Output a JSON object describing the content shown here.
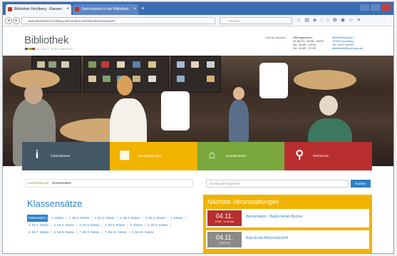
{
  "browser": {
    "tabs": [
      {
        "label": "Bibliothek Hochberg - Klassen"
      },
      {
        "label": "Sternstunden in der Bibliothek"
      }
    ],
    "new_tab": "+",
    "url": "www.bibliothek-hochberg.de/schulen-und-kitas/klassensaetze",
    "search_placeholder": "Suchen"
  },
  "site": {
    "logo": "Bibliothek",
    "logo_sub": "STADT HOCHBERG",
    "header_link": "Leichte Sprache",
    "hours": "Öffnungszeiten:\nDi. bis Fr.: 10:00 - 18:00\nSa.: 10:00 - 14:00\nSo.: 14:00 - 17:00",
    "address": "Bibliotheksplatz 1\n12345 Hochberg\nTel. 0123 456789\nbibliothek@hochberg.de"
  },
  "tiles": [
    {
      "icon": "i",
      "label": "Informationen",
      "color": "#445766"
    },
    {
      "icon": "▦",
      "label": "Veranstaltungen",
      "color": "#f2b300"
    },
    {
      "icon": "⌂",
      "label": "Lesestandorte",
      "color": "#7aa83c"
    },
    {
      "icon": "⚲",
      "label": "Recherche",
      "color": "#b82e2e"
    }
  ],
  "breadcrumb": {
    "home": "Leseförderung",
    "current": "Klassensätze"
  },
  "search": {
    "placeholder": "Suchbegriff eingeben",
    "button": "Suchen"
  },
  "klassensaetze": {
    "title": "Klassensätze",
    "items": [
      "Klassensätze",
      "1. Klasse",
      "1. bis 2. Klasse",
      "1. bis 3. Klasse",
      "2. bis 3. Klasse",
      "2. bis 4. Klasse",
      "3. Klasse",
      "3. bis 4. Klasse",
      "3. bis 5. Klasse",
      "4. bis 5. Klasse",
      "4. bis 6. Klasse",
      "5. Klasse",
      "5. bis 6. Klasse",
      "5. bis 7. Klasse",
      "5. bis 8. Klasse",
      "7. bis 8. Klasse",
      "7. bis 10. Klasse",
      "8. bis 10. Klasse"
    ]
  },
  "events": {
    "title": "Nächste Veranstaltungen",
    "items": [
      {
        "date": "04.11.",
        "time": "10:30 - 11:30 Uhr",
        "title": "Bücherbabys - Babys lieben Bücher",
        "color": "#b82e2e"
      },
      {
        "date": "04.11.",
        "time": "15:00 Uhr",
        "title": "Asyl ist ein Menschenrecht",
        "color": "#8a8a8a"
      }
    ]
  }
}
